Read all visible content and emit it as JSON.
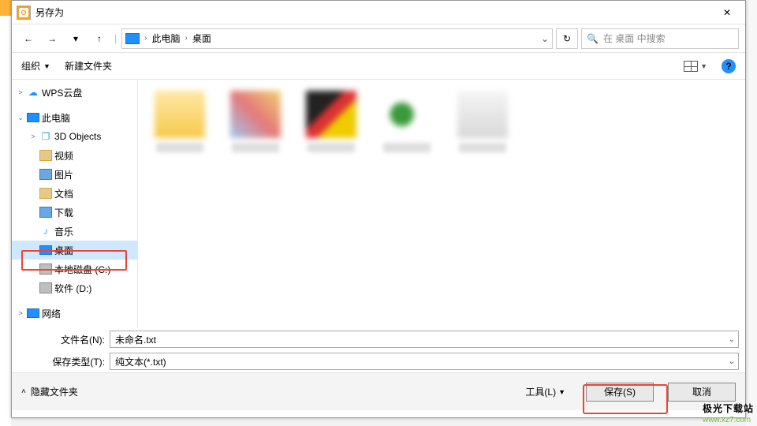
{
  "window": {
    "title": "另存为",
    "close_icon": "✕"
  },
  "nav": {
    "back": "←",
    "forward": "→",
    "dropdown": "▾",
    "up": "↑",
    "path": {
      "root": "此电脑",
      "current": "桌面"
    },
    "refresh": "↻",
    "search_placeholder": "在 桌面 中搜索"
  },
  "toolbar": {
    "organize": "组织",
    "new_folder": "新建文件夹",
    "help": "?"
  },
  "tree": [
    {
      "arrow": ">",
      "icon": "cloud",
      "label": "WPS云盘",
      "indent": 0
    },
    {
      "arrow": "v",
      "icon": "monitor",
      "label": "此电脑",
      "indent": 0
    },
    {
      "arrow": ">",
      "icon": "cube",
      "label": "3D Objects",
      "indent": 1
    },
    {
      "arrow": "",
      "icon": "folder tan",
      "label": "视频",
      "indent": 1
    },
    {
      "arrow": "",
      "icon": "blue",
      "label": "图片",
      "indent": 1
    },
    {
      "arrow": "",
      "icon": "folder tan",
      "label": "文档",
      "indent": 1
    },
    {
      "arrow": "",
      "icon": "blue",
      "label": "下载",
      "indent": 1
    },
    {
      "arrow": "",
      "icon": "note",
      "label": "音乐",
      "indent": 1,
      "glyph": "♪"
    },
    {
      "arrow": "",
      "icon": "monitor",
      "label": "桌面",
      "indent": 1,
      "selected": true
    },
    {
      "arrow": "",
      "icon": "disk",
      "label": "本地磁盘 (C:)",
      "indent": 1
    },
    {
      "arrow": "",
      "icon": "disk",
      "label": "软件 (D:)",
      "indent": 1
    },
    {
      "arrow": ">",
      "icon": "monitor",
      "label": "网络",
      "indent": 0
    }
  ],
  "fields": {
    "filename_label": "文件名(N):",
    "filename_value": "未命名.txt",
    "type_label": "保存类型(T):",
    "type_value": "纯文本(*.txt)"
  },
  "bottom": {
    "hide": "隐藏文件夹",
    "tools": "工具(L)",
    "save": "保存(S)",
    "cancel": "取消"
  },
  "watermark": {
    "line1": "极光下载站",
    "line2": "www.xz7.com"
  }
}
